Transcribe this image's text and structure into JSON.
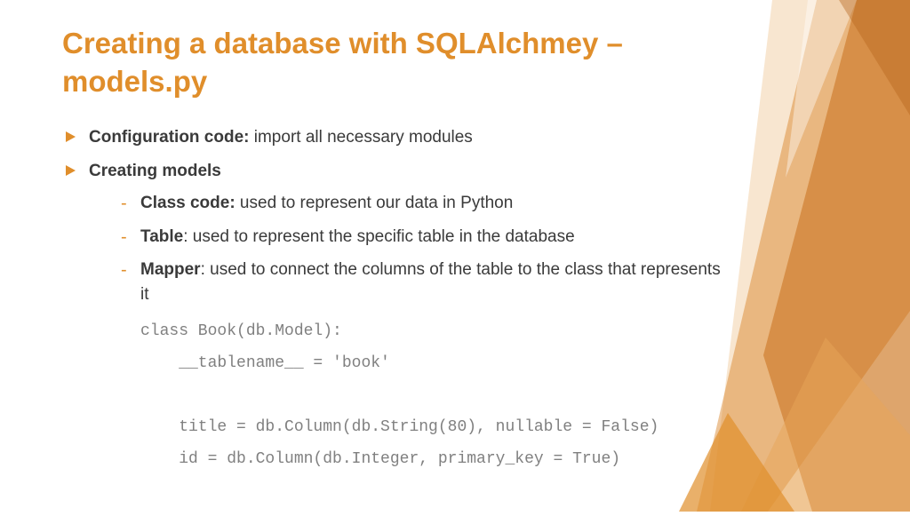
{
  "title": "Creating a database with SQLAlchmey – models.py",
  "bullets": [
    {
      "bold": "Configuration code:",
      "rest": " import all necessary modules"
    },
    {
      "bold": "Creating models",
      "rest": ""
    }
  ],
  "sub_bullets": [
    {
      "bold": "Class code:",
      "rest": " used to represent our data in Python"
    },
    {
      "bold": "Table",
      "rest": ": used to represent the specific table in the database"
    },
    {
      "bold": "Mapper",
      "rest": ": used to connect the columns of the table to the class that represents it"
    }
  ],
  "code": "class Book(db.Model):\n    __tablename__ = 'book'\n\n    title = db.Column(db.String(80), nullable = False)\n    id = db.Column(db.Integer, primary_key = True)"
}
